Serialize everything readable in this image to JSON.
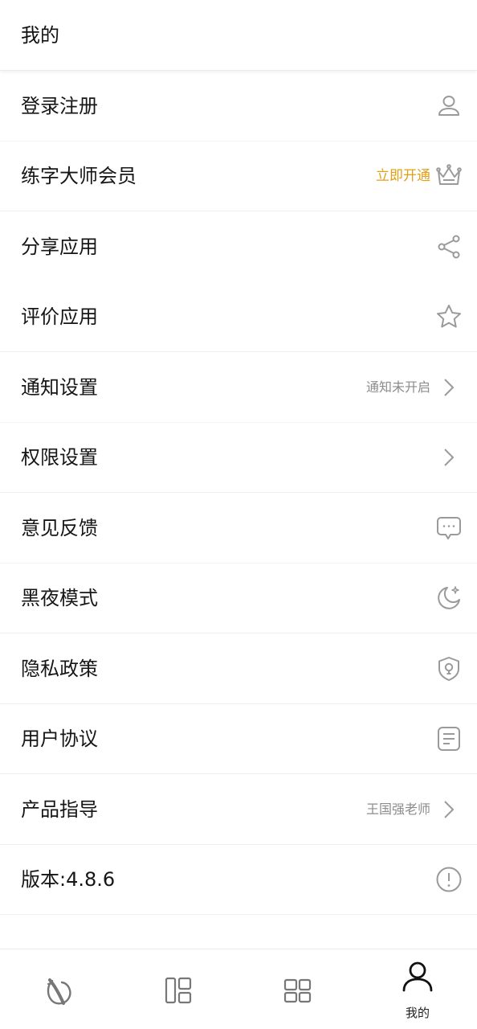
{
  "header": {
    "title": "我的"
  },
  "menu": {
    "login": {
      "label": "登录注册",
      "icon": "user-icon"
    },
    "vip": {
      "label": "练字大师会员",
      "extra": "立即开通",
      "icon": "crown-icon",
      "accent_color": "#e1a016"
    },
    "share": {
      "label": "分享应用",
      "icon": "share-icon"
    },
    "rate": {
      "label": "评价应用",
      "icon": "star-icon"
    },
    "notify": {
      "label": "通知设置",
      "extra": "通知未开启",
      "icon": "chevron-right-icon"
    },
    "permission": {
      "label": "权限设置",
      "icon": "chevron-right-icon"
    },
    "feedback": {
      "label": "意见反馈",
      "icon": "chat-icon"
    },
    "dark": {
      "label": "黑夜模式",
      "icon": "moon-icon"
    },
    "privacy": {
      "label": "隐私政策",
      "icon": "shield-icon"
    },
    "agreement": {
      "label": "用户协议",
      "icon": "document-icon"
    },
    "guide": {
      "label": "产品指导",
      "extra": "王国强老师",
      "icon": "chevron-right-icon"
    },
    "version": {
      "label": "版本:4.8.6",
      "icon": "info-icon"
    }
  },
  "tabbar": {
    "items": [
      {
        "icon": "brush-icon"
      },
      {
        "icon": "layout-icon"
      },
      {
        "icon": "grid-icon"
      },
      {
        "icon": "person-icon",
        "label": "我的",
        "active": true
      }
    ]
  },
  "colors": {
    "icon_gray": "#9a9a9a",
    "accent": "#e1a016",
    "divider": "#eeeeee"
  }
}
